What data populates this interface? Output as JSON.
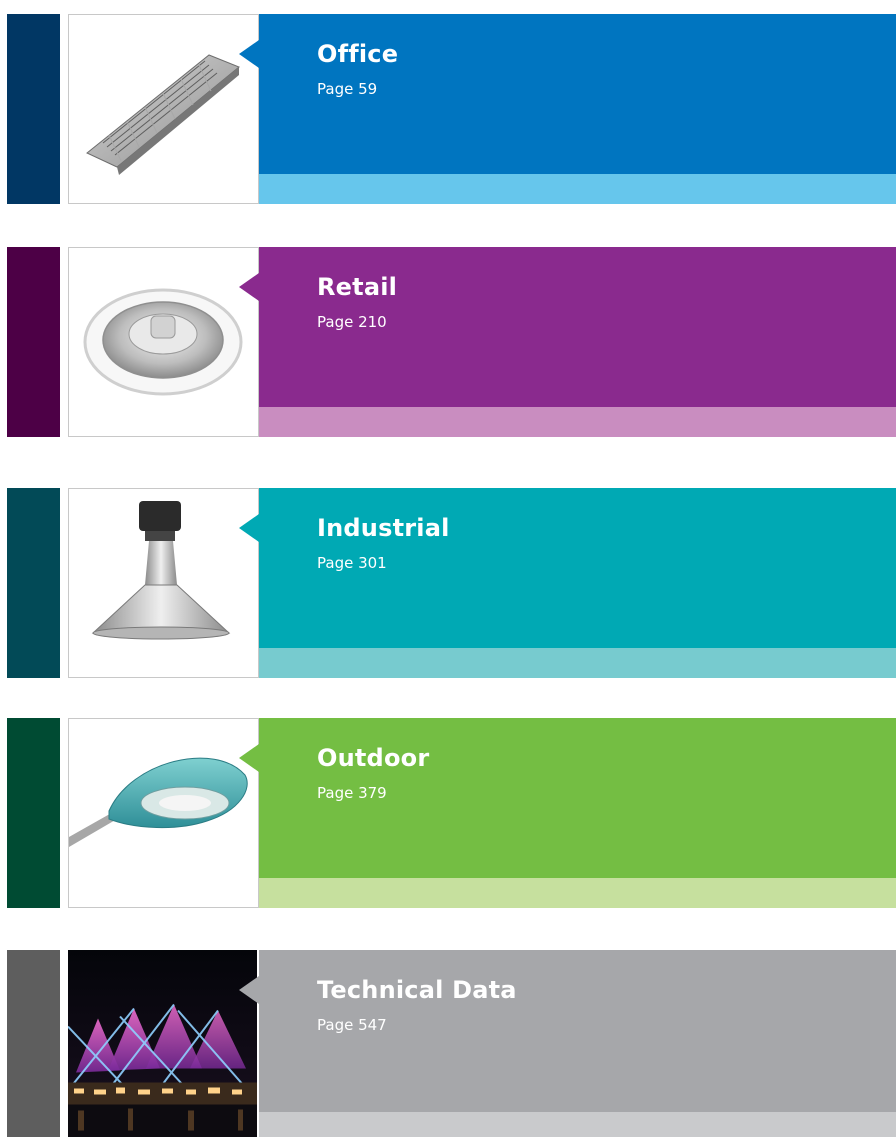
{
  "sections": [
    {
      "key": "office",
      "title": "Office",
      "page": "Page 59",
      "colors": {
        "edge": "#013764",
        "panel": "#0075C0",
        "strip": "#66C6EC"
      },
      "image": "office-luminaire"
    },
    {
      "key": "retail",
      "title": "Retail",
      "page": "Page 210",
      "colors": {
        "edge": "#4D0046",
        "panel": "#8A2A8E",
        "strip": "#C98DC0"
      },
      "image": "downlight"
    },
    {
      "key": "industrial",
      "title": "Industrial",
      "page": "Page 301",
      "colors": {
        "edge": "#024A57",
        "panel": "#00A9B4",
        "strip": "#77CBCF"
      },
      "image": "highbay-luminaire"
    },
    {
      "key": "outdoor",
      "title": "Outdoor",
      "page": "Page 379",
      "colors": {
        "edge": "#004B33",
        "panel": "#74BE43",
        "strip": "#C6E09E"
      },
      "image": "street-light"
    },
    {
      "key": "technical",
      "title": "Technical Data",
      "page": "Page 547",
      "colors": {
        "edge": "#5E5E5E",
        "panel": "#A6A7AA",
        "strip": "#C9CACC"
      },
      "image": "stadium-night"
    }
  ]
}
